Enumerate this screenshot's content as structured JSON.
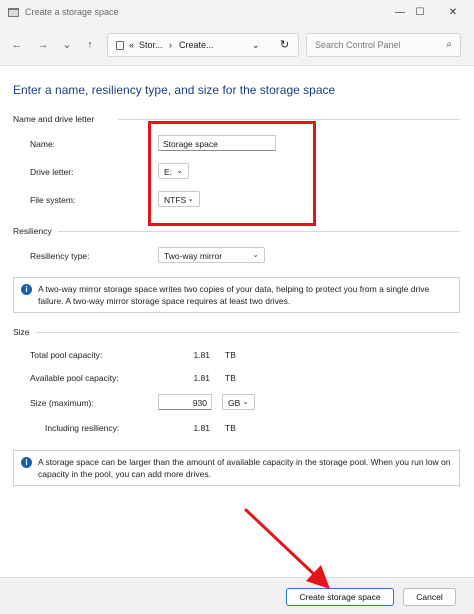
{
  "window": {
    "title": "Create a storage space",
    "controls": {
      "minimize": "—",
      "maximize": "☐",
      "close": "✕"
    }
  },
  "nav": {
    "back": "←",
    "forward": "→",
    "recent": "⌄",
    "up": "↑",
    "breadcrumb": [
      "«",
      "Stor...",
      "›",
      "Create..."
    ],
    "dropdown": "⌄",
    "refresh": "↻",
    "search_placeholder": "Search Control Panel",
    "search_icon": "⌕"
  },
  "main": {
    "heading": "Enter a name, resiliency type, and size for the storage space",
    "name_section": {
      "title": "Name and drive letter",
      "name_label": "Name:",
      "name_value": "Storage space",
      "drive_label": "Drive letter:",
      "drive_value": "E:",
      "fs_label": "File system:",
      "fs_value": "NTFS"
    },
    "resiliency": {
      "title": "Resiliency",
      "type_label": "Resiliency type:",
      "type_value": "Two-way mirror",
      "info": "A two-way mirror storage space writes two copies of your data, helping to protect you from a single drive failure. A two-way mirror storage space requires at least two drives."
    },
    "size": {
      "title": "Size",
      "total_label": "Total pool capacity:",
      "total_value": "1.81",
      "total_unit": "TB",
      "available_label": "Available pool capacity:",
      "available_value": "1.81",
      "available_unit": "TB",
      "max_label": "Size (maximum):",
      "max_value": "930",
      "max_unit": "GB",
      "incl_label": "Including resiliency:",
      "incl_value": "1.81",
      "incl_unit": "TB",
      "info": "A storage space can be larger than the amount of available capacity in the storage pool. When you run low on capacity in the pool, you can add more drives."
    }
  },
  "footer": {
    "create_label": "Create storage space",
    "cancel_label": "Cancel"
  },
  "annotations": {
    "highlight_color": "#e3151a",
    "info_icon": "i",
    "chevron": "⌄"
  }
}
